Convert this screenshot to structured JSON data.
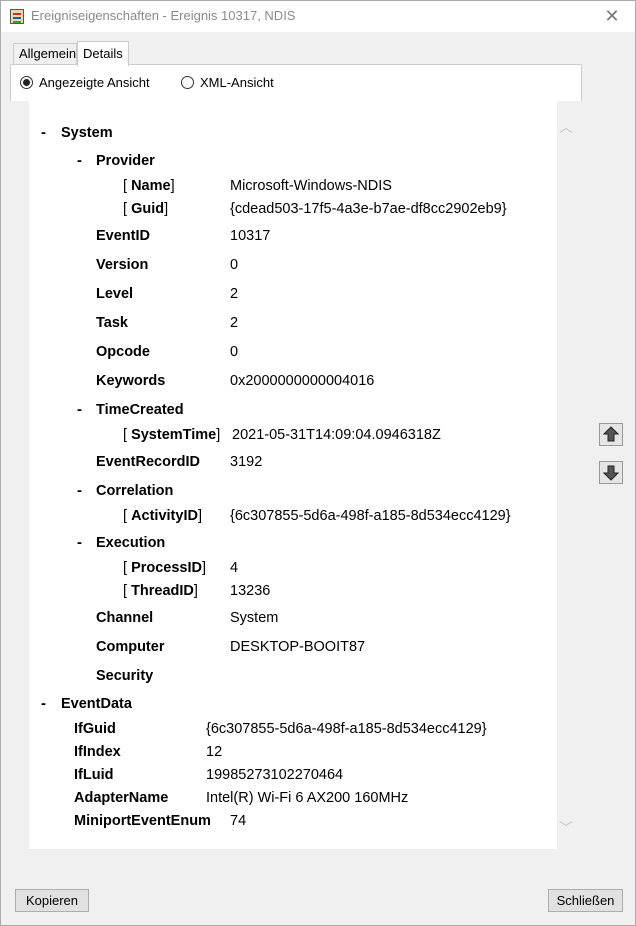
{
  "window": {
    "title": "Ereigniseigenschaften - Ereignis 10317, NDIS",
    "close_glyph": "✕"
  },
  "tabs": [
    {
      "label": "Allgemein",
      "selected": false
    },
    {
      "label": "Details",
      "selected": true
    }
  ],
  "view_options": {
    "friendly": {
      "label": "Angezeigte Ansicht",
      "checked": true
    },
    "xml": {
      "label": "XML-Ansicht",
      "checked": false
    }
  },
  "tree": {
    "minus": "-",
    "bracket_open": "[",
    "bracket_close": "]",
    "system": {
      "label": "System",
      "provider": {
        "label": "Provider",
        "name_key": "Name",
        "name_val": "Microsoft-Windows-NDIS",
        "guid_key": "Guid",
        "guid_val": "{cdead503-17f5-4a3e-b7ae-df8cc2902eb9}"
      },
      "event_id": {
        "key": "EventID",
        "val": "10317"
      },
      "version": {
        "key": "Version",
        "val": "0"
      },
      "level": {
        "key": "Level",
        "val": "2"
      },
      "task": {
        "key": "Task",
        "val": "2"
      },
      "opcode": {
        "key": "Opcode",
        "val": "0"
      },
      "keywords": {
        "key": "Keywords",
        "val": "0x2000000000004016"
      },
      "time_created": {
        "label": "TimeCreated",
        "key": "SystemTime",
        "val": "2021-05-31T14:09:04.0946318Z"
      },
      "event_record_id": {
        "key": "EventRecordID",
        "val": "3192"
      },
      "correlation": {
        "label": "Correlation",
        "key": "ActivityID",
        "val": "{6c307855-5d6a-498f-a185-8d534ecc4129}"
      },
      "execution": {
        "label": "Execution",
        "pid_key": "ProcessID",
        "pid_val": "4",
        "tid_key": "ThreadID",
        "tid_val": "13236"
      },
      "channel": {
        "key": "Channel",
        "val": "System"
      },
      "computer": {
        "key": "Computer",
        "val": "DESKTOP-BOOIT87"
      },
      "security": {
        "key": "Security"
      }
    },
    "event_data": {
      "label": "EventData",
      "rows": [
        {
          "key": "IfGuid",
          "val": "{6c307855-5d6a-498f-a185-8d534ecc4129}"
        },
        {
          "key": "IfIndex",
          "val": "12"
        },
        {
          "key": "IfLuid",
          "val": "19985273102270464"
        },
        {
          "key": "AdapterName",
          "val": "Intel(R) Wi-Fi 6 AX200 160MHz"
        },
        {
          "key": "MiniportEventEnum",
          "val": "74"
        }
      ]
    }
  },
  "scrollbar": {
    "up_glyph": "︿",
    "down_glyph": "﹀"
  },
  "buttons": {
    "copy": "Kopieren",
    "close": "Schließen"
  }
}
